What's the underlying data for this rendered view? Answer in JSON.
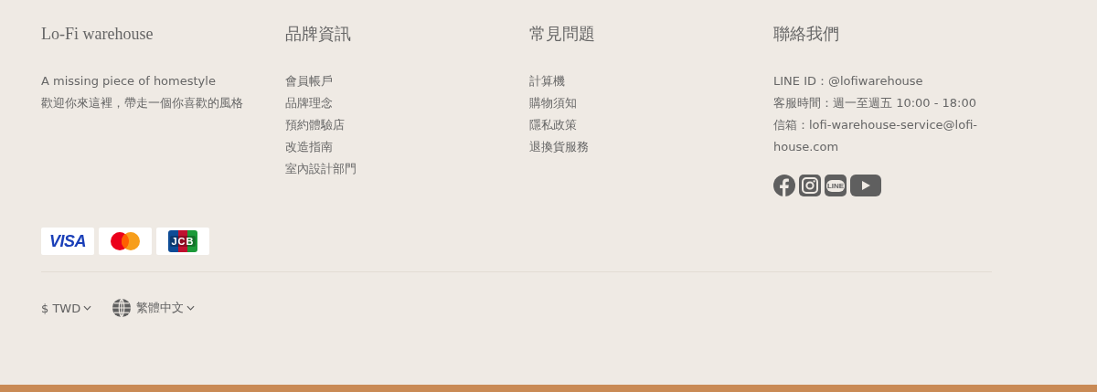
{
  "columns": [
    {
      "title": "Lo-Fi warehouse",
      "lines": [
        "A missing piece of homestyle",
        "歡迎你來這裡，帶走一個你喜歡的風格"
      ]
    },
    {
      "title": "品牌資訊",
      "links": [
        "會員帳戶",
        "品牌理念",
        "預約體驗店",
        "改造指南",
        "室內設計部門"
      ]
    },
    {
      "title": "常見問題",
      "links": [
        "計算機",
        "購物須知",
        "隱私政策",
        "退換貨服務"
      ]
    },
    {
      "title": "聯絡我們",
      "lines": [
        "LINE ID：@lofiwarehouse",
        "客服時間：週一至週五 10:00 - 18:00",
        "信箱：lofi-warehouse-service@lofi-house.com"
      ],
      "social": [
        {
          "kind": "facebook"
        },
        {
          "kind": "instagram"
        },
        {
          "kind": "line",
          "label": "LINE"
        },
        {
          "kind": "youtube"
        }
      ]
    }
  ],
  "payments": [
    {
      "kind": "visa",
      "label": "VISA"
    },
    {
      "kind": "mastercard"
    },
    {
      "kind": "jcb",
      "label": "JCB"
    }
  ],
  "currency": "$ TWD",
  "language": "繁體中文"
}
